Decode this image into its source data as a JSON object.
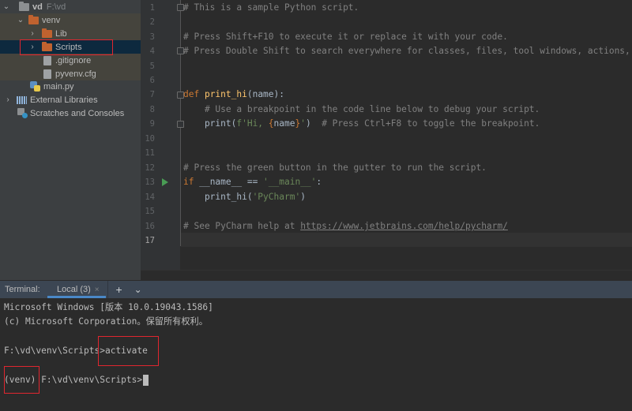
{
  "project_tree": {
    "root": {
      "name": "vd",
      "path": "F:\\vd"
    },
    "items": [
      {
        "label": "venv",
        "type": "folder",
        "expanded": true
      },
      {
        "label": "Lib",
        "type": "folder",
        "expanded": false
      },
      {
        "label": "Scripts",
        "type": "folder",
        "expanded": false,
        "selected": true
      },
      {
        "label": ".gitignore",
        "type": "file"
      },
      {
        "label": "pyvenv.cfg",
        "type": "file"
      },
      {
        "label": "main.py",
        "type": "python-file"
      },
      {
        "label": "External Libraries",
        "type": "libraries"
      },
      {
        "label": "Scratches and Consoles",
        "type": "scratches"
      }
    ]
  },
  "editor": {
    "current_line": 17,
    "line_numbers": [
      "1",
      "2",
      "3",
      "4",
      "5",
      "6",
      "7",
      "8",
      "9",
      "10",
      "11",
      "12",
      "13",
      "14",
      "15",
      "16",
      "17"
    ],
    "lines": {
      "l1": "# This is a sample Python script.",
      "l3": "# Press Shift+F10 to execute it or replace it with your code.",
      "l4": "# Press Double Shift to search everywhere for classes, files, tool windows, actions, and settings.",
      "l7_kw": "def ",
      "l7_fn": "print_hi",
      "l7_rest": "(name):",
      "l8": "    # Use a breakpoint in the code line below to debug your script.",
      "l9_a": "    print(",
      "l9_str1": "f'Hi, ",
      "l9_brace1": "{",
      "l9_name": "name",
      "l9_brace2": "}",
      "l9_str2": "'",
      "l9_b": ")  ",
      "l9_cm": "# Press Ctrl+F8 to toggle the breakpoint.",
      "l12": "# Press the green button in the gutter to run the script.",
      "l13_kw": "if ",
      "l13_a": "__name__ == ",
      "l13_str": "'__main__'",
      "l13_b": ":",
      "l14_a": "    print_hi(",
      "l14_str": "'PyCharm'",
      "l14_b": ")",
      "l16_a": "# See PyCharm help at ",
      "l16_url": "https://www.jetbrains.com/help/pycharm/"
    }
  },
  "terminal": {
    "title": "Terminal:",
    "tab_label": "Local (3)",
    "close_glyph": "×",
    "add_glyph": "+",
    "menu_glyph": "⌄",
    "output": [
      "Microsoft Windows [版本 10.0.19043.1586]",
      "(c) Microsoft Corporation。保留所有权利。",
      "",
      "F:\\vd\\venv\\Scripts>activate",
      "",
      "(venv) F:\\vd\\venv\\Scripts>"
    ]
  },
  "annotations": {
    "highlight_color": "#e0262f"
  }
}
